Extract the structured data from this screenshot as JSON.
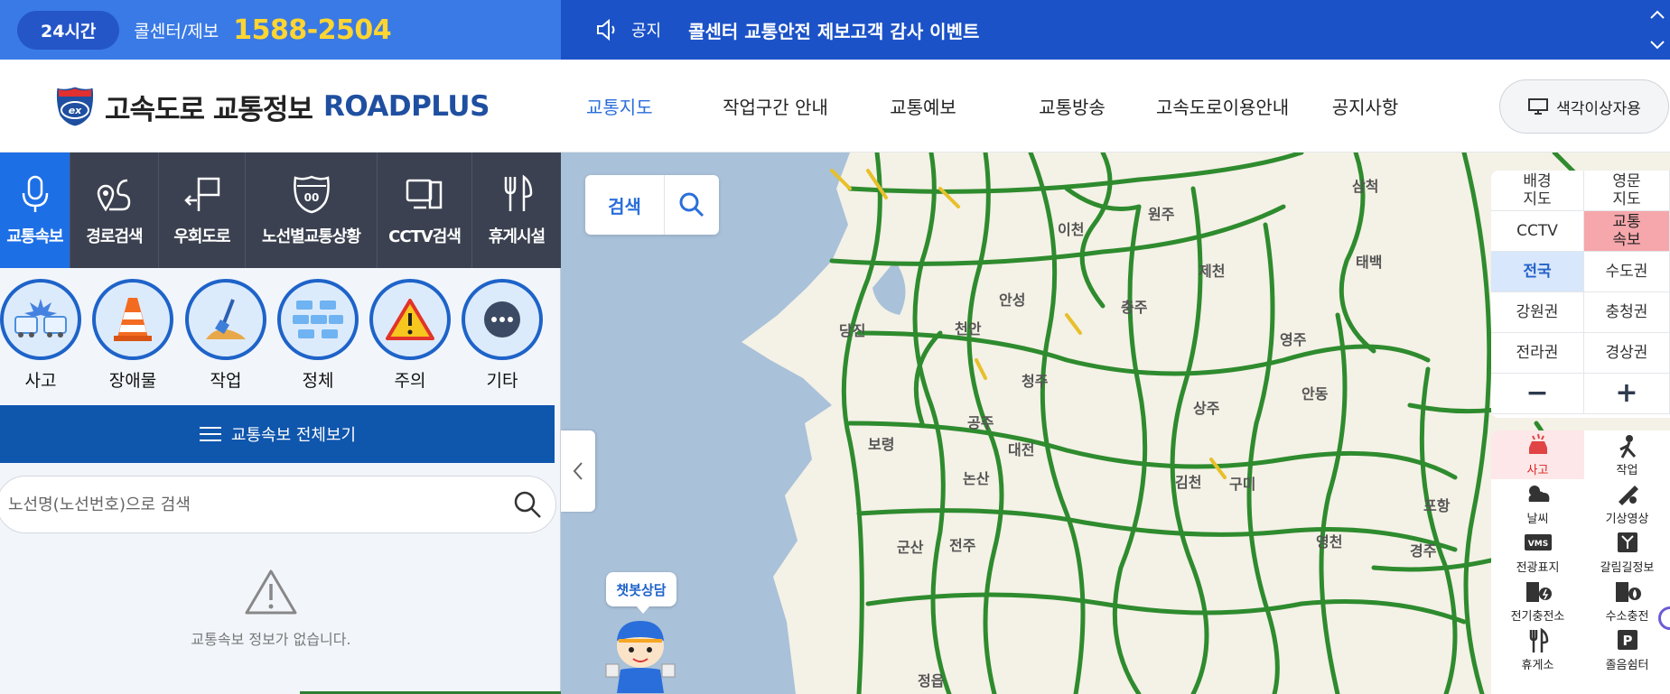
{
  "topbar": {
    "badge": "24시간",
    "callcenter_label": "콜센터/제보",
    "phone": "1588-2504",
    "notice_label": "공지",
    "notice_text": "콜센터 교통안전 제보고객 감사 이벤트"
  },
  "header": {
    "logo_title": "고속도로 교통정보",
    "logo_brand": "ROADPLUS",
    "nav": [
      {
        "label": "교통지도"
      },
      {
        "label": "작업구간 안내"
      },
      {
        "label": "교통예보"
      },
      {
        "label": "교통방송"
      },
      {
        "label": "고속도로이용안내"
      },
      {
        "label": "공지사항"
      }
    ],
    "color_button": "색각이상자용"
  },
  "left": {
    "tabs": [
      {
        "label": "교통속보",
        "icon": "microphone-icon"
      },
      {
        "label": "경로검색",
        "icon": "route-icon"
      },
      {
        "label": "우회도로",
        "icon": "detour-sign-icon"
      },
      {
        "label": "노선별교통상황",
        "icon": "highway-shield-icon"
      },
      {
        "label": "CCTV검색",
        "icon": "cctv-icon"
      },
      {
        "label": "휴게시설",
        "icon": "fork-knife-icon"
      }
    ],
    "categories": [
      {
        "label": "사고",
        "icon": "accident-icon"
      },
      {
        "label": "장애물",
        "icon": "traffic-cone-icon"
      },
      {
        "label": "작업",
        "icon": "shovel-icon"
      },
      {
        "label": "정체",
        "icon": "congestion-icon"
      },
      {
        "label": "주의",
        "icon": "warning-icon"
      },
      {
        "label": "기타",
        "icon": "more-icon"
      }
    ],
    "view_all": "교통속보 전체보기",
    "search_placeholder": "노선명(노선번호)으로 검색",
    "empty_text": "교통속보 정보가 없습니다."
  },
  "map": {
    "search_label": "검색",
    "chatbot_label": "챗봇상담",
    "places": [
      {
        "name": "삼척"
      },
      {
        "name": "이천"
      },
      {
        "name": "원주"
      },
      {
        "name": "제천"
      },
      {
        "name": "태백"
      },
      {
        "name": "안성"
      },
      {
        "name": "충주"
      },
      {
        "name": "당진"
      },
      {
        "name": "천안"
      },
      {
        "name": "영주"
      },
      {
        "name": "청주"
      },
      {
        "name": "안동"
      },
      {
        "name": "상주"
      },
      {
        "name": "공주"
      },
      {
        "name": "보령"
      },
      {
        "name": "대전"
      },
      {
        "name": "논산"
      },
      {
        "name": "김천"
      },
      {
        "name": "구미"
      },
      {
        "name": "포항"
      },
      {
        "name": "군산"
      },
      {
        "name": "전주"
      },
      {
        "name": "경주"
      },
      {
        "name": "정읍"
      },
      {
        "name": "영천"
      }
    ]
  },
  "controls": {
    "grid": [
      {
        "label": "배경\n지도"
      },
      {
        "label": "영문\n지도"
      },
      {
        "label": "CCTV"
      },
      {
        "label": "교통\n속보"
      },
      {
        "label": "전국"
      },
      {
        "label": "수도권"
      },
      {
        "label": "강원권"
      },
      {
        "label": "충청권"
      },
      {
        "label": "전라권"
      },
      {
        "label": "경상권"
      },
      {
        "label": "−"
      },
      {
        "label": "+"
      }
    ],
    "layers": [
      {
        "label": "사고",
        "icon": "accident-car-icon"
      },
      {
        "label": "작업",
        "icon": "worker-icon"
      },
      {
        "label": "날씨",
        "icon": "weather-icon"
      },
      {
        "label": "기상영상",
        "icon": "weather-video-icon"
      },
      {
        "label": "전광표지",
        "icon": "vms-icon"
      },
      {
        "label": "갈림길정보",
        "icon": "junction-icon"
      },
      {
        "label": "전기충전소",
        "icon": "ev-charger-icon"
      },
      {
        "label": "수소충전",
        "icon": "hydrogen-charger-icon"
      },
      {
        "label": "휴게소",
        "icon": "rest-area-icon"
      },
      {
        "label": "졸음쉼터",
        "icon": "parking-icon"
      }
    ]
  },
  "colors": {
    "primary": "#1b52c7",
    "accent": "#2a6edb",
    "phone": "#ffd531",
    "road": "#2e8b2e",
    "land": "#f4f1e6",
    "sea": "#a9c1d9"
  }
}
